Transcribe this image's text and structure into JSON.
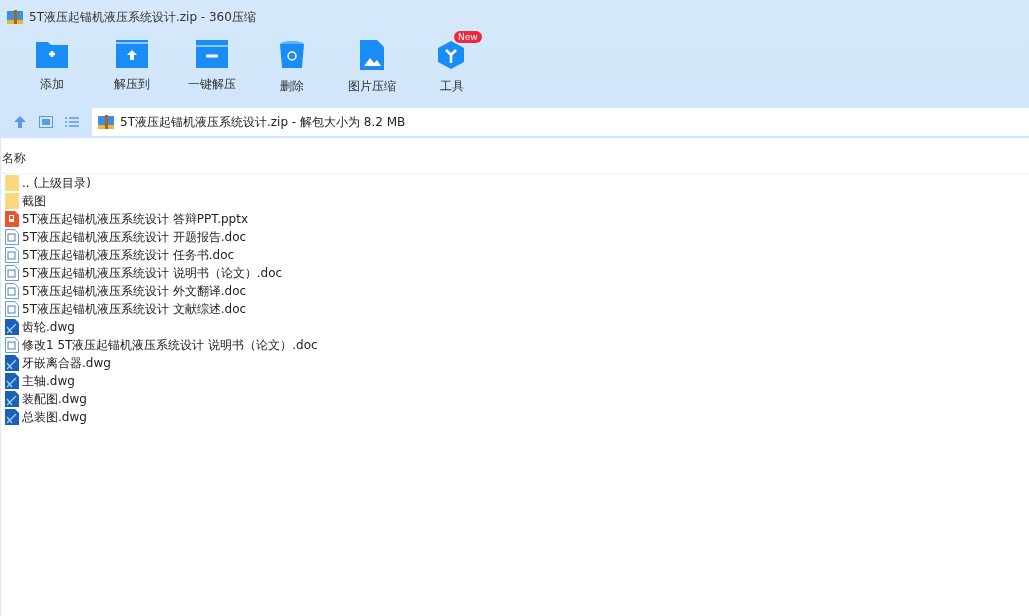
{
  "window": {
    "title": "5T液压起锚机液压系统设计.zip - 360压缩"
  },
  "toolbar": [
    {
      "kind": "add",
      "label": "添加"
    },
    {
      "kind": "extract",
      "label": "解压到"
    },
    {
      "kind": "oneclick",
      "label": "一键解压"
    },
    {
      "kind": "delete",
      "label": "删除"
    },
    {
      "kind": "image",
      "label": "图片压缩"
    },
    {
      "kind": "tools",
      "label": "工具",
      "badge": "New"
    }
  ],
  "address_bar": {
    "path": "5T液压起锚机液压系统设计.zip - 解包大小为 8.2 MB"
  },
  "table": {
    "columns": [
      "名称"
    ],
    "rows": [
      {
        "kind": "folder",
        "name": ".. (上级目录)"
      },
      {
        "kind": "folder",
        "name": "截图"
      },
      {
        "kind": "ppt",
        "name": "5T液压起锚机液压系统设计 答辩PPT.pptx"
      },
      {
        "kind": "doc",
        "name": "5T液压起锚机液压系统设计 开题报告.doc"
      },
      {
        "kind": "doc",
        "name": "5T液压起锚机液压系统设计 任务书.doc"
      },
      {
        "kind": "doc",
        "name": "5T液压起锚机液压系统设计 说明书（论文）.doc"
      },
      {
        "kind": "doc",
        "name": "5T液压起锚机液压系统设计 外文翻译.doc"
      },
      {
        "kind": "doc",
        "name": "5T液压起锚机液压系统设计 文献综述.doc"
      },
      {
        "kind": "dwg",
        "name": "齿轮.dwg"
      },
      {
        "kind": "doc",
        "name": "修改1 5T液压起锚机液压系统设计 说明书（论文）.doc"
      },
      {
        "kind": "dwg",
        "name": "牙嵌离合器.dwg"
      },
      {
        "kind": "dwg",
        "name": "主轴.dwg"
      },
      {
        "kind": "dwg",
        "name": "装配图.dwg"
      },
      {
        "kind": "dwg",
        "name": "总装图.dwg"
      }
    ]
  }
}
